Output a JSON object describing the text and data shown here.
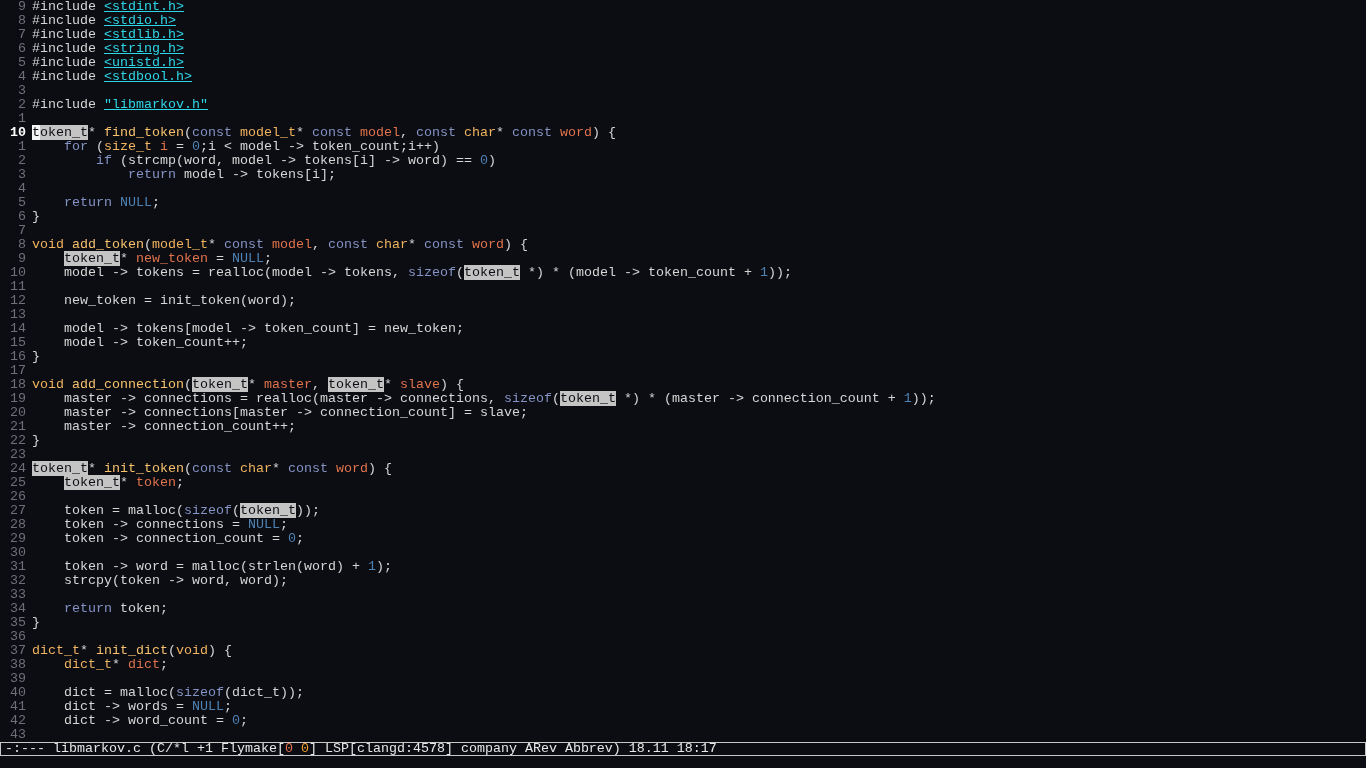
{
  "editor": {
    "lines": [
      {
        "number": "9",
        "current": false,
        "segments": [
          {
            "text": "#include ",
            "kind": "plain"
          },
          {
            "text": "<stdint.h>",
            "kind": "header"
          }
        ]
      },
      {
        "number": "8",
        "current": false,
        "segments": [
          {
            "text": "#include ",
            "kind": "plain"
          },
          {
            "text": "<stdio.h>",
            "kind": "header"
          }
        ]
      },
      {
        "number": "7",
        "current": false,
        "segments": [
          {
            "text": "#include ",
            "kind": "plain"
          },
          {
            "text": "<stdlib.h>",
            "kind": "header"
          }
        ]
      },
      {
        "number": "6",
        "current": false,
        "segments": [
          {
            "text": "#include ",
            "kind": "plain"
          },
          {
            "text": "<string.h>",
            "kind": "header"
          }
        ]
      },
      {
        "number": "5",
        "current": false,
        "segments": [
          {
            "text": "#include ",
            "kind": "plain"
          },
          {
            "text": "<unistd.h>",
            "kind": "header"
          }
        ]
      },
      {
        "number": "4",
        "current": false,
        "segments": [
          {
            "text": "#include ",
            "kind": "plain"
          },
          {
            "text": "<stdbool.h>",
            "kind": "header"
          }
        ]
      },
      {
        "number": "3",
        "current": false
      },
      {
        "number": "2",
        "current": false,
        "segments": [
          {
            "text": "#include ",
            "kind": "plain"
          },
          {
            "text": "\"libmarkov.h\"",
            "kind": "header"
          }
        ]
      },
      {
        "number": "1",
        "current": false
      },
      {
        "number": "10",
        "current": true,
        "segments": [
          {
            "text": "t",
            "kind": "cursor"
          },
          {
            "text": "oken_t",
            "kind": "symbol"
          },
          {
            "text": "* ",
            "kind": "plain"
          },
          {
            "text": "find_token",
            "kind": "function"
          },
          {
            "text": "(",
            "kind": "plain"
          },
          {
            "text": "const ",
            "kind": "keyword"
          },
          {
            "text": "model_t",
            "kind": "type"
          },
          {
            "text": "* ",
            "kind": "plain"
          },
          {
            "text": "const ",
            "kind": "keyword"
          },
          {
            "text": "model",
            "kind": "variable"
          },
          {
            "text": ", ",
            "kind": "plain"
          },
          {
            "text": "const ",
            "kind": "keyword"
          },
          {
            "text": "char",
            "kind": "type"
          },
          {
            "text": "* ",
            "kind": "plain"
          },
          {
            "text": "const ",
            "kind": "keyword"
          },
          {
            "text": "word",
            "kind": "variable"
          },
          {
            "text": ") {",
            "kind": "plain"
          }
        ]
      },
      {
        "number": "1",
        "current": false,
        "segments": [
          {
            "text": "    for",
            "kind": "keyword"
          },
          {
            "text": " (",
            "kind": "plain"
          },
          {
            "text": "size_t ",
            "kind": "type"
          },
          {
            "text": "i",
            "kind": "variable"
          },
          {
            "text": " = ",
            "kind": "plain"
          },
          {
            "text": "0",
            "kind": "constant"
          },
          {
            "text": ";i < model -> token_count;i++)",
            "kind": "plain"
          }
        ]
      },
      {
        "number": "2",
        "current": false,
        "segments": [
          {
            "text": "        if",
            "kind": "keyword"
          },
          {
            "text": " (strcmp(word, model -> tokens[i] -> word) == ",
            "kind": "plain"
          },
          {
            "text": "0",
            "kind": "constant"
          },
          {
            "text": ")",
            "kind": "plain"
          }
        ]
      },
      {
        "number": "3",
        "current": false,
        "segments": [
          {
            "text": "            return",
            "kind": "keyword"
          },
          {
            "text": " model -> tokens[i];",
            "kind": "plain"
          }
        ]
      },
      {
        "number": "4",
        "current": false
      },
      {
        "number": "5",
        "current": false,
        "segments": [
          {
            "text": "    return ",
            "kind": "keyword"
          },
          {
            "text": "NULL",
            "kind": "constant"
          },
          {
            "text": ";",
            "kind": "plain"
          }
        ]
      },
      {
        "number": "6",
        "current": false,
        "segments": [
          {
            "text": "}",
            "kind": "plain"
          }
        ]
      },
      {
        "number": "7",
        "current": false
      },
      {
        "number": "8",
        "current": false,
        "segments": [
          {
            "text": "void ",
            "kind": "type"
          },
          {
            "text": "add_token",
            "kind": "function"
          },
          {
            "text": "(",
            "kind": "plain"
          },
          {
            "text": "model_t",
            "kind": "type"
          },
          {
            "text": "* ",
            "kind": "plain"
          },
          {
            "text": "const ",
            "kind": "keyword"
          },
          {
            "text": "model",
            "kind": "variable"
          },
          {
            "text": ", ",
            "kind": "plain"
          },
          {
            "text": "const ",
            "kind": "keyword"
          },
          {
            "text": "char",
            "kind": "type"
          },
          {
            "text": "* ",
            "kind": "plain"
          },
          {
            "text": "const ",
            "kind": "keyword"
          },
          {
            "text": "word",
            "kind": "variable"
          },
          {
            "text": ") {",
            "kind": "plain"
          }
        ]
      },
      {
        "number": "9",
        "current": false,
        "segments": [
          {
            "text": "    token_t",
            "kind": "symbol"
          },
          {
            "text": "* ",
            "kind": "plain"
          },
          {
            "text": "new_token",
            "kind": "variable"
          },
          {
            "text": " = ",
            "kind": "plain"
          },
          {
            "text": "NULL",
            "kind": "constant"
          },
          {
            "text": ";",
            "kind": "plain"
          }
        ]
      },
      {
        "number": "10",
        "current": false,
        "segments": [
          {
            "text": "    model -> tokens = realloc(model -> tokens, ",
            "kind": "plain"
          },
          {
            "text": "sizeof",
            "kind": "keyword"
          },
          {
            "text": "(",
            "kind": "plain"
          },
          {
            "text": "token_t",
            "kind": "symbol"
          },
          {
            "text": " *) * (model -> token_count + ",
            "kind": "plain"
          },
          {
            "text": "1",
            "kind": "constant"
          },
          {
            "text": "));",
            "kind": "plain"
          }
        ]
      },
      {
        "number": "11",
        "current": false
      },
      {
        "number": "12",
        "current": false,
        "segments": [
          {
            "text": "    new_token = init_token(word);",
            "kind": "plain"
          }
        ]
      },
      {
        "number": "13",
        "current": false
      },
      {
        "number": "14",
        "current": false,
        "segments": [
          {
            "text": "    model -> tokens[model -> token_count] = new_token;",
            "kind": "plain"
          }
        ]
      },
      {
        "number": "15",
        "current": false,
        "segments": [
          {
            "text": "    model -> token_count++;",
            "kind": "plain"
          }
        ]
      },
      {
        "number": "16",
        "current": false,
        "segments": [
          {
            "text": "}",
            "kind": "plain"
          }
        ]
      },
      {
        "number": "17",
        "current": false
      },
      {
        "number": "18",
        "current": false,
        "segments": [
          {
            "text": "void ",
            "kind": "type"
          },
          {
            "text": "add_connection",
            "kind": "function"
          },
          {
            "text": "(",
            "kind": "plain"
          },
          {
            "text": "token_t",
            "kind": "symbol"
          },
          {
            "text": "* ",
            "kind": "plain"
          },
          {
            "text": "master",
            "kind": "variable"
          },
          {
            "text": ", ",
            "kind": "plain"
          },
          {
            "text": "token_t",
            "kind": "symbol"
          },
          {
            "text": "* ",
            "kind": "plain"
          },
          {
            "text": "slave",
            "kind": "variable"
          },
          {
            "text": ") {",
            "kind": "plain"
          }
        ]
      },
      {
        "number": "19",
        "current": false,
        "segments": [
          {
            "text": "    master -> connections = realloc(master -> connections, ",
            "kind": "plain"
          },
          {
            "text": "sizeof",
            "kind": "keyword"
          },
          {
            "text": "(",
            "kind": "plain"
          },
          {
            "text": "token_t",
            "kind": "symbol"
          },
          {
            "text": " *) * (master -> connection_count + ",
            "kind": "plain"
          },
          {
            "text": "1",
            "kind": "constant"
          },
          {
            "text": "));",
            "kind": "plain"
          }
        ]
      },
      {
        "number": "20",
        "current": false,
        "segments": [
          {
            "text": "    master -> connections[master -> connection_count] = slave;",
            "kind": "plain"
          }
        ]
      },
      {
        "number": "21",
        "current": false,
        "segments": [
          {
            "text": "    master -> connection_count++;",
            "kind": "plain"
          }
        ]
      },
      {
        "number": "22",
        "current": false,
        "segments": [
          {
            "text": "}",
            "kind": "plain"
          }
        ]
      },
      {
        "number": "23",
        "current": false
      },
      {
        "number": "24",
        "current": false,
        "segments": [
          {
            "text": "token_t",
            "kind": "symbol"
          },
          {
            "text": "* ",
            "kind": "plain"
          },
          {
            "text": "init_token",
            "kind": "function"
          },
          {
            "text": "(",
            "kind": "plain"
          },
          {
            "text": "const ",
            "kind": "keyword"
          },
          {
            "text": "char",
            "kind": "type"
          },
          {
            "text": "* ",
            "kind": "plain"
          },
          {
            "text": "const ",
            "kind": "keyword"
          },
          {
            "text": "word",
            "kind": "variable"
          },
          {
            "text": ") {",
            "kind": "plain"
          }
        ]
      },
      {
        "number": "25",
        "current": false,
        "segments": [
          {
            "text": "    token_t",
            "kind": "symbol"
          },
          {
            "text": "* ",
            "kind": "plain"
          },
          {
            "text": "token",
            "kind": "variable"
          },
          {
            "text": ";",
            "kind": "plain"
          }
        ]
      },
      {
        "number": "26",
        "current": false
      },
      {
        "number": "27",
        "current": false,
        "segments": [
          {
            "text": "    token = malloc(",
            "kind": "plain"
          },
          {
            "text": "sizeof",
            "kind": "keyword"
          },
          {
            "text": "(",
            "kind": "plain"
          },
          {
            "text": "token_t",
            "kind": "symbol"
          },
          {
            "text": "));",
            "kind": "plain"
          }
        ]
      },
      {
        "number": "28",
        "current": false,
        "segments": [
          {
            "text": "    token -> connections = ",
            "kind": "plain"
          },
          {
            "text": "NULL",
            "kind": "constant"
          },
          {
            "text": ";",
            "kind": "plain"
          }
        ]
      },
      {
        "number": "29",
        "current": false,
        "segments": [
          {
            "text": "    token -> connection_count = ",
            "kind": "plain"
          },
          {
            "text": "0",
            "kind": "constant"
          },
          {
            "text": ";",
            "kind": "plain"
          }
        ]
      },
      {
        "number": "30",
        "current": false
      },
      {
        "number": "31",
        "current": false,
        "segments": [
          {
            "text": "    token -> word = malloc(strlen(word) + ",
            "kind": "plain"
          },
          {
            "text": "1",
            "kind": "constant"
          },
          {
            "text": ");",
            "kind": "plain"
          }
        ]
      },
      {
        "number": "32",
        "current": false,
        "segments": [
          {
            "text": "    strcpy(token -> word, word);",
            "kind": "plain"
          }
        ]
      },
      {
        "number": "33",
        "current": false
      },
      {
        "number": "34",
        "current": false,
        "segments": [
          {
            "text": "    return",
            "kind": "keyword"
          },
          {
            "text": " token;",
            "kind": "plain"
          }
        ]
      },
      {
        "number": "35",
        "current": false,
        "segments": [
          {
            "text": "}",
            "kind": "plain"
          }
        ]
      },
      {
        "number": "36",
        "current": false
      },
      {
        "number": "37",
        "current": false,
        "segments": [
          {
            "text": "dict_t",
            "kind": "type"
          },
          {
            "text": "* ",
            "kind": "plain"
          },
          {
            "text": "init_dict",
            "kind": "function"
          },
          {
            "text": "(",
            "kind": "plain"
          },
          {
            "text": "void",
            "kind": "type"
          },
          {
            "text": ") {",
            "kind": "plain"
          }
        ]
      },
      {
        "number": "38",
        "current": false,
        "segments": [
          {
            "text": "    dict_t",
            "kind": "type"
          },
          {
            "text": "* ",
            "kind": "plain"
          },
          {
            "text": "dict",
            "kind": "variable"
          },
          {
            "text": ";",
            "kind": "plain"
          }
        ]
      },
      {
        "number": "39",
        "current": false
      },
      {
        "number": "40",
        "current": false,
        "segments": [
          {
            "text": "    dict = malloc(",
            "kind": "plain"
          },
          {
            "text": "sizeof",
            "kind": "keyword"
          },
          {
            "text": "(dict_t));",
            "kind": "plain"
          }
        ]
      },
      {
        "number": "41",
        "current": false,
        "segments": [
          {
            "text": "    dict -> words = ",
            "kind": "plain"
          },
          {
            "text": "NULL",
            "kind": "constant"
          },
          {
            "text": ";",
            "kind": "plain"
          }
        ]
      },
      {
        "number": "42",
        "current": false,
        "segments": [
          {
            "text": "    dict -> word_count = ",
            "kind": "plain"
          },
          {
            "text": "0",
            "kind": "constant"
          },
          {
            "text": ";",
            "kind": "plain"
          }
        ]
      },
      {
        "number": "43",
        "current": false
      }
    ]
  },
  "mode_line": {
    "segments": [
      {
        "text": "-:--- libmarkov.c (C/*l +1 Flymake[",
        "kind": "plain"
      },
      {
        "text": "0",
        "kind": "error-count"
      },
      {
        "text": " 0",
        "kind": "warning-count"
      },
      {
        "text": "] LSP[clangd:4578] company ARev Abbrev) 18.11 18:17",
        "kind": "plain"
      }
    ]
  }
}
